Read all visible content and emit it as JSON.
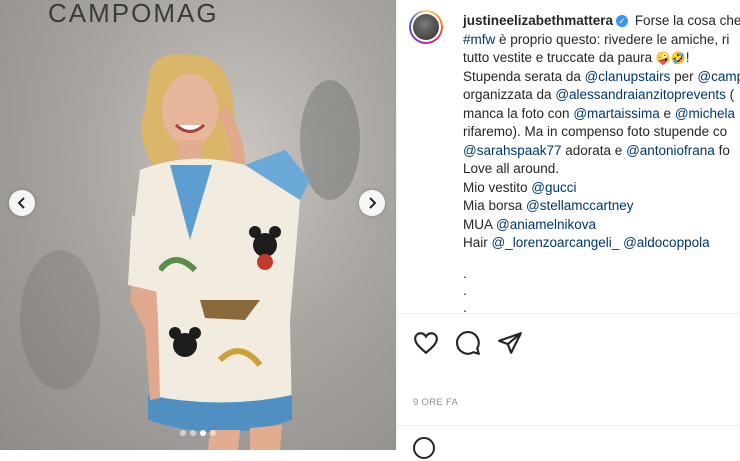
{
  "photo": {
    "wall_text": "CAMPOMAG",
    "prev_icon": "chevron-left-icon",
    "next_icon": "chevron-right-icon",
    "carousel_count": 4,
    "carousel_active_index": 2
  },
  "post": {
    "username": "justineelizabethmattera",
    "verified_icon": "verified-badge-icon",
    "caption_lines": [
      {
        "segments": [
          {
            "t": "Forse la cosa che",
            "link": false
          }
        ]
      },
      {
        "segments": [
          {
            "t": "#mfw",
            "link": true
          },
          {
            "t": " è proprio questo: rivedere le amiche, ri",
            "link": false
          }
        ]
      },
      {
        "segments": [
          {
            "t": "tutto vestite e truccate da paura ",
            "link": false
          },
          {
            "t": "🤪🤣",
            "link": false
          },
          {
            "t": "!",
            "link": false
          }
        ]
      },
      {
        "segments": [
          {
            "t": "Stupenda serata da ",
            "link": false
          },
          {
            "t": "@clanupstairs",
            "link": true
          },
          {
            "t": " per ",
            "link": false
          },
          {
            "t": "@camp",
            "link": true
          }
        ]
      },
      {
        "segments": [
          {
            "t": "organizzata da ",
            "link": false
          },
          {
            "t": "@alessandraianzitoprevents",
            "link": true
          },
          {
            "t": " (",
            "link": false
          }
        ]
      },
      {
        "segments": [
          {
            "t": "manca la foto con ",
            "link": false
          },
          {
            "t": "@martaissima",
            "link": true
          },
          {
            "t": " e ",
            "link": false
          },
          {
            "t": "@michela",
            "link": true
          }
        ]
      },
      {
        "segments": [
          {
            "t": "rifaremo). Ma in compenso foto stupende co",
            "link": false
          }
        ]
      },
      {
        "segments": [
          {
            "t": "@sarahspaak77",
            "link": true
          },
          {
            "t": " adorata e ",
            "link": false
          },
          {
            "t": "@antoniofrana",
            "link": true
          },
          {
            "t": " fo",
            "link": false
          }
        ]
      },
      {
        "segments": [
          {
            "t": "Love all around.",
            "link": false
          }
        ]
      },
      {
        "segments": [
          {
            "t": "Mio vestito ",
            "link": false
          },
          {
            "t": "@gucci",
            "link": true
          }
        ]
      },
      {
        "segments": [
          {
            "t": "Mia borsa ",
            "link": false
          },
          {
            "t": "@stellamccartney",
            "link": true
          }
        ]
      },
      {
        "segments": [
          {
            "t": "MUA ",
            "link": false
          },
          {
            "t": "@aniamelnikova",
            "link": true
          }
        ]
      },
      {
        "segments": [
          {
            "t": "Hair ",
            "link": false
          },
          {
            "t": "@_lorenzoarcangeli_",
            "link": true
          },
          {
            "t": " ",
            "link": false
          },
          {
            "t": "@aldocoppola",
            "link": true
          }
        ]
      }
    ],
    "dots": [
      ".",
      ".",
      "."
    ],
    "timestamp": "9 ORE FA",
    "actions": [
      "heart-icon",
      "comment-icon",
      "share-icon"
    ],
    "emoji_icon": "emoji-icon"
  },
  "colors": {
    "link": "#00376b",
    "text": "#262626",
    "muted": "#8e8e8e",
    "verified": "#3897f0"
  }
}
